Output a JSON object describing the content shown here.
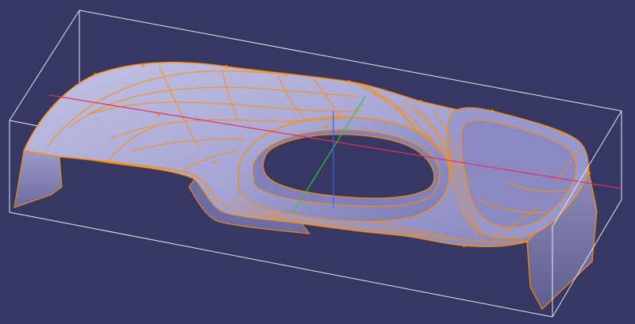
{
  "viewport": {
    "background": "#363763"
  },
  "colors": {
    "bounding_box": "#e8e8f0",
    "surface_light": "#b9b9dd",
    "surface_mid": "#8d8cc6",
    "surface_dark": "#5e5d9a",
    "wall": "#76759f",
    "edges": "#ff8c00",
    "x_axis": "#e0305c",
    "y_axis": "#39c03a",
    "z_axis": "#3b63e6"
  },
  "scene": {
    "model": "3d-part",
    "display_mode": "shading-with-edges"
  }
}
